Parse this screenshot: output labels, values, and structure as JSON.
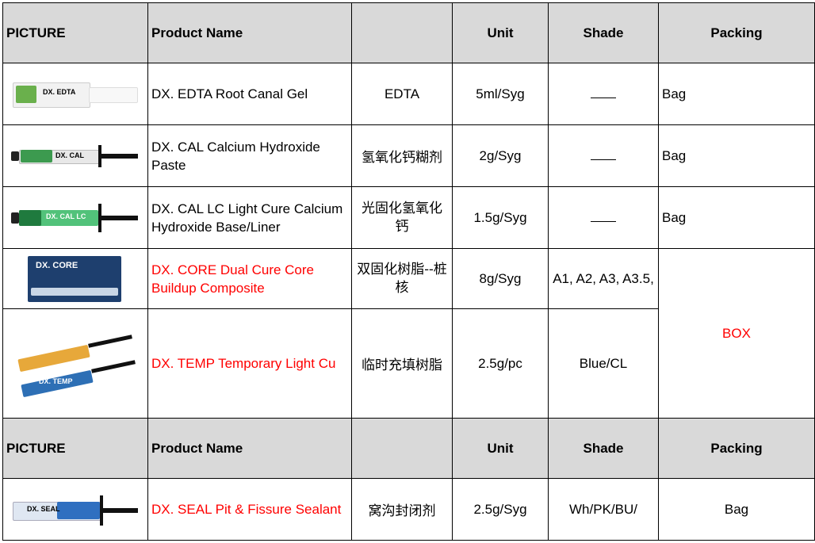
{
  "header": {
    "picture": "PICTURE",
    "product_name": "Product Name",
    "unit": "Unit",
    "shade": "Shade",
    "packing": "Packing"
  },
  "rows": [
    {
      "image": "syringe-edta-icon",
      "name": "DX. EDTA Root Canal Gel",
      "cn": "EDTA",
      "unit": "5ml/Syg",
      "shade": "",
      "packing": "Bag"
    },
    {
      "image": "syringe-cal-icon",
      "name": "DX. CAL Calcium Hydroxide Paste",
      "cn": "氢氧化钙糊剂",
      "unit": "2g/Syg",
      "shade": "",
      "packing": "Bag"
    },
    {
      "image": "syringe-cal-lc-icon",
      "name": "DX. CAL LC Light Cure Calcium Hydroxide Base/Liner",
      "cn": "光固化氢氧化钙",
      "unit": "1.5g/Syg",
      "shade": "",
      "packing": "Bag"
    },
    {
      "image": "core-box-syringe-icon",
      "name": "DX. CORE Dual Cure Core Buildup Composite",
      "cn": "双固化树脂--桩核",
      "unit": "8g/Syg",
      "shade": "A1, A2, A3, A3.5,",
      "packing": "BOX"
    },
    {
      "image": "temp-syringes-icon",
      "name": "DX. TEMP Temporary Light Cu",
      "cn": "临时充填树脂",
      "unit": "2.5g/pc",
      "shade": "Blue/CL",
      "packing": "BOX"
    }
  ],
  "row2_header": {
    "picture": "PICTURE",
    "product_name": "Product Name",
    "unit": "Unit",
    "shade": "Shade",
    "packing": "Packing"
  },
  "row_seal": {
    "image": "syringe-seal-icon",
    "name": "DX. SEAL Pit & Fissure Sealant",
    "cn": "窝沟封闭剂",
    "unit": "2.5g/Syg",
    "shade": "Wh/PK/BU/",
    "packing": "Bag"
  },
  "syringe_labels": {
    "edta": "DX. EDTA",
    "cal": "DX. CAL",
    "cal_lc": "DX. CAL LC",
    "core": "DX. CORE",
    "temp": "DX. TEMP",
    "seal": "DX. SEAL"
  },
  "colors": {
    "header_bg": "#d9d9d9",
    "red_text": "#ff0000"
  }
}
